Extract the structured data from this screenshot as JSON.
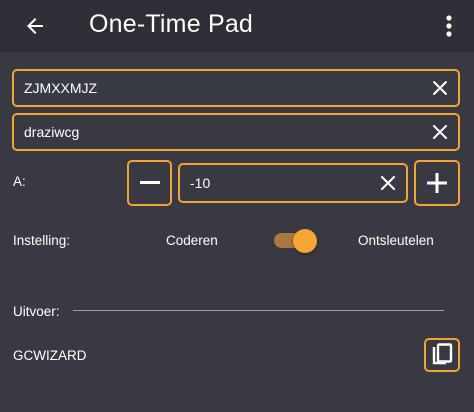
{
  "app_bar": {
    "title": "One-Time Pad",
    "back_icon": "arrow-left-icon",
    "menu_icon": "more-vert-icon"
  },
  "inputs": {
    "text": {
      "value": "ZJMXXMJZ"
    },
    "key": {
      "value": "draziwcg"
    }
  },
  "offset": {
    "label": "A:",
    "value": "-10",
    "decrement_icon": "minus-icon",
    "increment_icon": "plus-icon"
  },
  "mode": {
    "label": "Instelling:",
    "left_option": "Coderen",
    "right_option": "Ontsleutelen",
    "switch_on": true
  },
  "output": {
    "label": "Uitvoer:",
    "value": "GCWIZARD",
    "copy_icon": "copy-icon"
  },
  "colors": {
    "background": "#393943",
    "app_bar": "#2e2e36",
    "accent": "#f4a32e",
    "switch_track": "#a9793f",
    "text": "#ffffff"
  }
}
